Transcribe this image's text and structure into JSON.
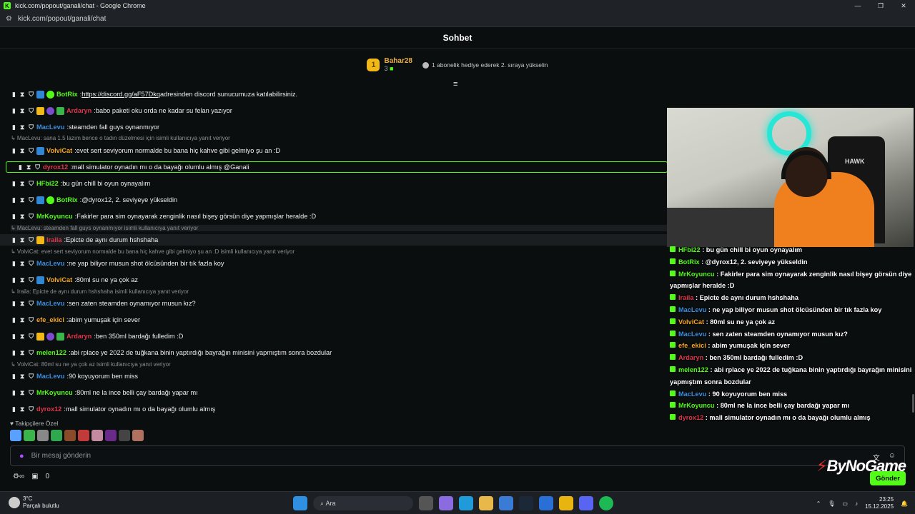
{
  "window": {
    "title": "kick.com/popout/ganali/chat - Google Chrome",
    "url": "kick.com/popout/ganali/chat",
    "controls": [
      "—",
      "❐",
      "✕"
    ]
  },
  "header": {
    "title": "Sohbet"
  },
  "pinned": {
    "rank": "1",
    "user": "Bahar28",
    "count": "3",
    "hint": "1 abonelik hediye ederek 2. sıraya yükselin"
  },
  "colors": {
    "accent": "#53fc18",
    "background": "#0b0e0f"
  },
  "messages": [
    {
      "name": "BotRix",
      "color": "#53fc18",
      "badges": [
        "b-blue",
        "b-green"
      ],
      "pre": "",
      "link": "https://discord.gg/aF57Dkq",
      "text": " adresinden discord sunucumuza katılabilirsiniz."
    },
    {
      "name": "Ardaryn",
      "color": "#e0364b",
      "badges": [
        "b-gold",
        "b-purple",
        "b-grn2"
      ],
      "text": "babo paketi oku orda ne kadar su felan yazıyor"
    },
    {
      "name": "MacLevu",
      "color": "#3d8fe0",
      "badges": [],
      "text": "steamden fall guys oynanmıyor"
    },
    {
      "name": "VolviCat",
      "color": "#f6a623",
      "badges": [
        "b-blue"
      ],
      "text": "evet sert seviyorum normalde bu bana hiç kahve gibi gelmiyo şu an :D"
    },
    {
      "name": "dyrox12",
      "color": "#e0364b",
      "badges": [],
      "text": "mall simulator oynadın mı o da bayağı olumlu almış @Ganali"
    },
    {
      "name": "HFbi22",
      "color": "#53fc18",
      "badges": [],
      "text": "bu gün chill bi oyun oynayalım"
    },
    {
      "name": "BotRix",
      "color": "#53fc18",
      "badges": [
        "b-blue",
        "b-green"
      ],
      "text": "@dyrox12, 2. seviyeye yükseldin"
    },
    {
      "name": "MrKoyuncu",
      "color": "#53fc18",
      "badges": [],
      "text": "Fakirler para sim oynayarak zenginlik nasıl bişey görsün diye yapmışlar heralde :D"
    },
    {
      "name": "Iraila",
      "color": "#e0364b",
      "badges": [
        "b-gold"
      ],
      "text": "Epicte de aynı durum hshshaha"
    },
    {
      "name": "MacLevu",
      "color": "#3d8fe0",
      "badges": [],
      "text": "ne yap biliyor musun shot ölcüsünden bir tık fazla koy"
    },
    {
      "name": "VolviCat",
      "color": "#f6a623",
      "badges": [
        "b-blue"
      ],
      "text": "80ml su ne ya çok az"
    },
    {
      "name": "MacLevu",
      "color": "#3d8fe0",
      "badges": [],
      "text": "sen zaten steamden oynamıyor musun kız?"
    },
    {
      "name": "efe_ekici",
      "color": "#f6a623",
      "badges": [],
      "text": "abim yumuşak için sever"
    },
    {
      "name": "Ardaryn",
      "color": "#e0364b",
      "badges": [
        "b-gold",
        "b-purple",
        "b-grn2"
      ],
      "text": "ben 350ml bardağı fulledim :D"
    },
    {
      "name": "melen122",
      "color": "#53fc18",
      "badges": [],
      "text": "abi rplace ye 2022 de tuğkana binin yaptırdığı bayrağın minisini yapmıştım sonra bozdular"
    },
    {
      "name": "MacLevu",
      "color": "#3d8fe0",
      "badges": [],
      "text": "90 koyuyorum ben miss"
    },
    {
      "name": "MrKoyuncu",
      "color": "#53fc18",
      "badges": [],
      "text": "80ml ne la ince belli çay bardağı yapar mı"
    },
    {
      "name": "dyrox12",
      "color": "#e0364b",
      "badges": [],
      "text": "mall simulator oynadın mı o da bayağı olumlu almış"
    }
  ],
  "replies": [
    "MacLevu: sana 1.5 lazım bence o tadın düzelmesi için isimli kullanıcıya yanıt veriyor",
    "MacLevu: steamden fall guys oynanmıyor isimli kullanıcıya yanıt veriyor",
    "VolviCat: evet sert seviyorum normalde bu bana hiç kahve gibi gelmiyo şu an :D isimli kullanıcıya yanıt veriyor",
    "Iraila: Epicte de aynı durum hshshaha isimli kullanıcıya yanıt veriyor",
    "VolviCat: 80ml su ne ya çok az isimli kullanıcıya yanıt veriyor"
  ],
  "composer": {
    "tip_label": "Takipçilere Özel",
    "placeholder": "Bir mesaj gönderin",
    "points": "0",
    "send": "Gönder"
  },
  "overlay": [
    {
      "name": "HFbi22",
      "color": "#53fc18",
      "text": ": bu gün chill bi oyun oynayalım"
    },
    {
      "name": "BotRix",
      "color": "#53fc18",
      "text": ": @dyrox12, 2. seviyeye yükseldin"
    },
    {
      "name": "MrKoyuncu",
      "color": "#53fc18",
      "text": ": Fakirler para sim oynayarak zenginlik nasıl bişey görsün diye yapmışlar heralde :D"
    },
    {
      "name": "Iraila",
      "color": "#e0364b",
      "text": ": Epicte de aynı durum hshshaha"
    },
    {
      "name": "MacLevu",
      "color": "#3d8fe0",
      "text": ": ne yap biliyor musun shot ölcüsünden bir tık fazla koy"
    },
    {
      "name": "VolviCat",
      "color": "#f6a623",
      "text": ": 80ml su ne ya çok az"
    },
    {
      "name": "MacLevu",
      "color": "#3d8fe0",
      "text": ": sen zaten steamden oynamıyor musun kız?"
    },
    {
      "name": "efe_ekici",
      "color": "#f6a623",
      "text": ": abim yumuşak için sever"
    },
    {
      "name": "Ardaryn",
      "color": "#e0364b",
      "text": ": ben 350ml bardağı fulledim :D"
    },
    {
      "name": "melen122",
      "color": "#53fc18",
      "text": ": abi rplace ye 2022 de tuğkana binin yaptırdığı bayrağın minisini yapmıştım sonra bozdular"
    },
    {
      "name": "MacLevu",
      "color": "#3d8fe0",
      "text": ": 90 koyuyorum ben miss"
    },
    {
      "name": "MrKoyuncu",
      "color": "#53fc18",
      "text": ": 80ml ne la ince belli çay bardağı yapar mı"
    },
    {
      "name": "dyrox12",
      "color": "#e0364b",
      "text": ": mall simulator oynadın mı o da bayağı olumlu almış"
    }
  ],
  "cam": {
    "chair_text": "HAWK"
  },
  "watermark": {
    "brand": "ByNoGame"
  },
  "taskbar": {
    "temp": "3°C",
    "weather": "Parçalı bulutlu",
    "search": "Ara",
    "time": "23:25",
    "date": "15.12.2025"
  }
}
